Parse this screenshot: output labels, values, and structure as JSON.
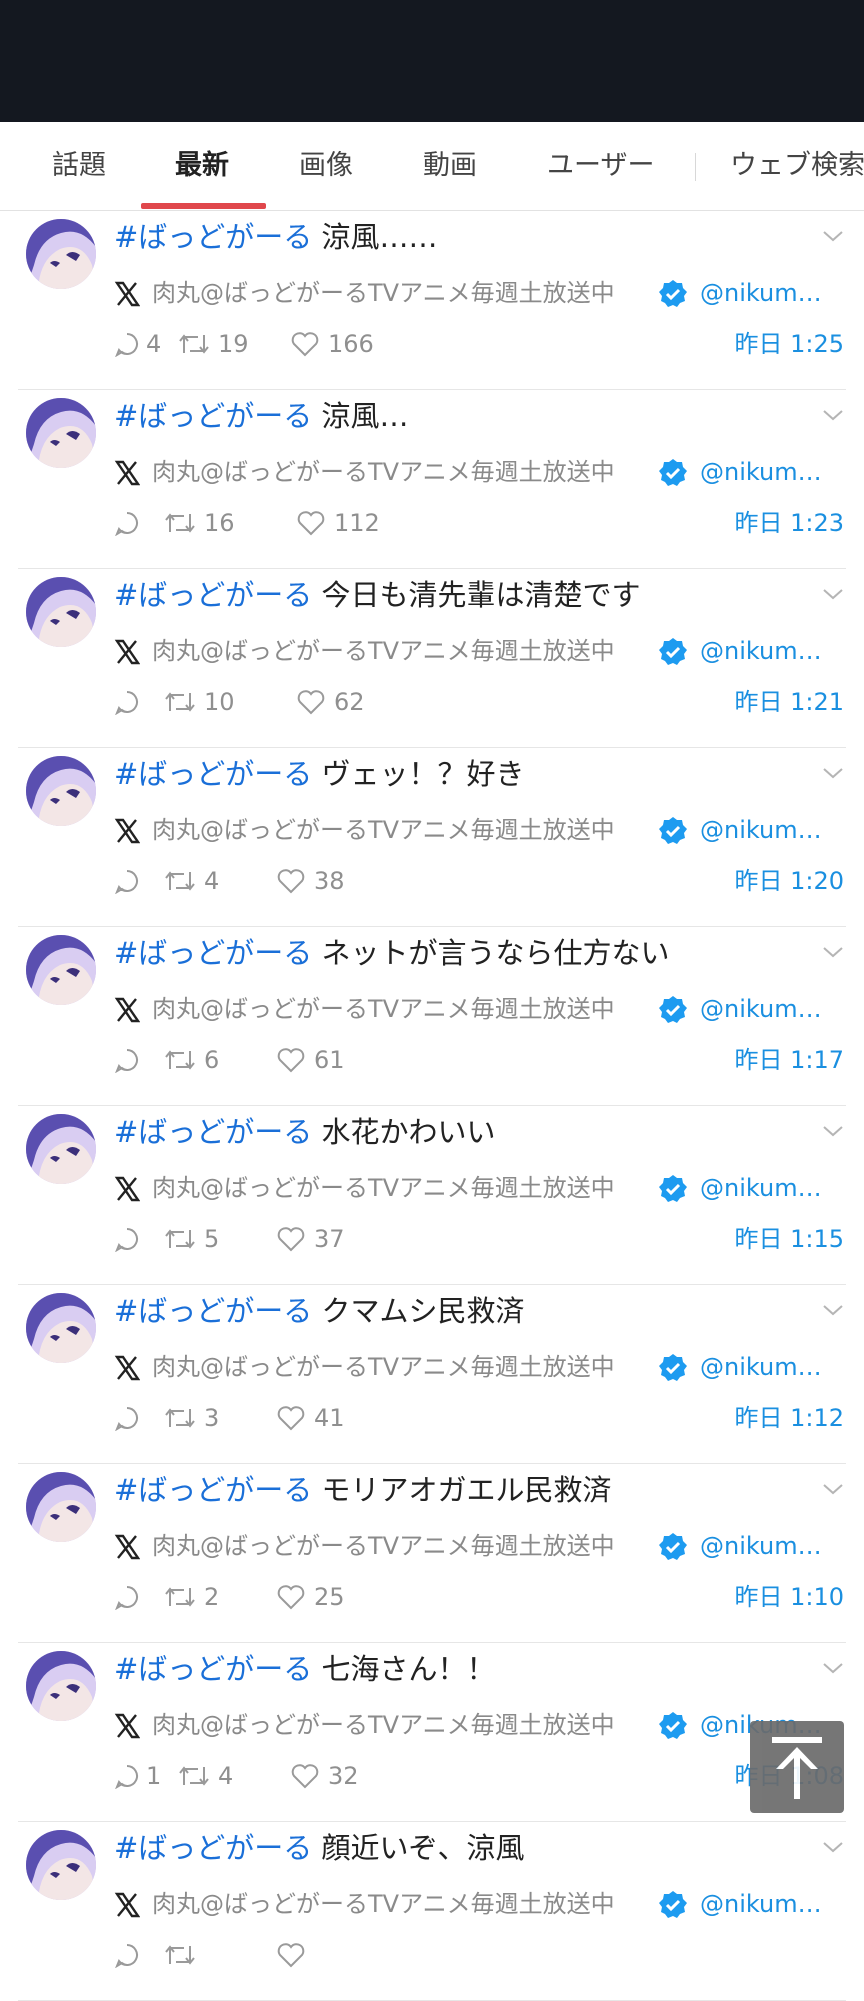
{
  "tabs": [
    {
      "label": "話題",
      "active": false
    },
    {
      "label": "最新",
      "active": true
    },
    {
      "label": "画像",
      "active": false
    },
    {
      "label": "動画",
      "active": false
    },
    {
      "label": "ユーザー",
      "active": false
    },
    {
      "label": "ウェブ検索",
      "active": false
    }
  ],
  "posts": [
    {
      "hashtag": "#ばっどがーる",
      "text": " 涼風……",
      "author": "肉丸@ばっどがーるTVアニメ毎週土放送中",
      "handle": "@nikumaru",
      "replies": "4",
      "reposts": "19",
      "likes": "166",
      "time": "昨日 1:25"
    },
    {
      "hashtag": "#ばっどがーる",
      "text": " 涼風…",
      "author": "肉丸@ばっどがーるTVアニメ毎週土放送中",
      "handle": "@nikumaru",
      "replies": "",
      "reposts": "16",
      "likes": "112",
      "time": "昨日 1:23"
    },
    {
      "hashtag": "#ばっどがーる",
      "text": " 今日も清先輩は清楚です",
      "author": "肉丸@ばっどがーるTVアニメ毎週土放送中",
      "handle": "@nikumaru",
      "replies": "",
      "reposts": "10",
      "likes": "62",
      "time": "昨日 1:21"
    },
    {
      "hashtag": "#ばっどがーる",
      "text": " ヴェッ！？好き",
      "author": "肉丸@ばっどがーるTVアニメ毎週土放送中",
      "handle": "@nikumaru",
      "replies": "",
      "reposts": "4",
      "likes": "38",
      "time": "昨日 1:20"
    },
    {
      "hashtag": "#ばっどがーる",
      "text": " ネットが言うなら仕方ない",
      "author": "肉丸@ばっどがーるTVアニメ毎週土放送中",
      "handle": "@nikumaru",
      "replies": "",
      "reposts": "6",
      "likes": "61",
      "time": "昨日 1:17"
    },
    {
      "hashtag": "#ばっどがーる",
      "text": " 水花かわいい",
      "author": "肉丸@ばっどがーるTVアニメ毎週土放送中",
      "handle": "@nikumaru",
      "replies": "",
      "reposts": "5",
      "likes": "37",
      "time": "昨日 1:15"
    },
    {
      "hashtag": "#ばっどがーる",
      "text": " クマムシ民救済",
      "author": "肉丸@ばっどがーるTVアニメ毎週土放送中",
      "handle": "@nikumaru",
      "replies": "",
      "reposts": "3",
      "likes": "41",
      "time": "昨日 1:12"
    },
    {
      "hashtag": "#ばっどがーる",
      "text": " モリアオガエル民救済",
      "author": "肉丸@ばっどがーるTVアニメ毎週土放送中",
      "handle": "@nikumaru",
      "replies": "",
      "reposts": "2",
      "likes": "25",
      "time": "昨日 1:10"
    },
    {
      "hashtag": "#ばっどがーる",
      "text": " 七海さん！！",
      "author": "肉丸@ばっどがーるTVアニメ毎週土放送中",
      "handle": "@nikumaru",
      "replies": "1",
      "reposts": "4",
      "likes": "32",
      "time": "昨日 1:08"
    },
    {
      "hashtag": "#ばっどがーる",
      "text": " 顔近いぞ、涼風",
      "author": "肉丸@ばっどがーるTVアニメ毎週土放送中",
      "handle": "@nikumaru",
      "replies": "",
      "reposts": "",
      "likes": "",
      "time": ""
    }
  ],
  "colors": {
    "accent": "#e0474c",
    "link": "#1a8fe0",
    "hashtag": "#1a6fd8",
    "topbar": "#141820"
  },
  "icons": {
    "reply": "reply-icon",
    "repost": "repost-icon",
    "like": "heart-icon",
    "source": "x-logo-icon",
    "verified": "verified-badge-icon",
    "more": "chevron-down-icon",
    "scroll": "arrow-up-icon"
  }
}
